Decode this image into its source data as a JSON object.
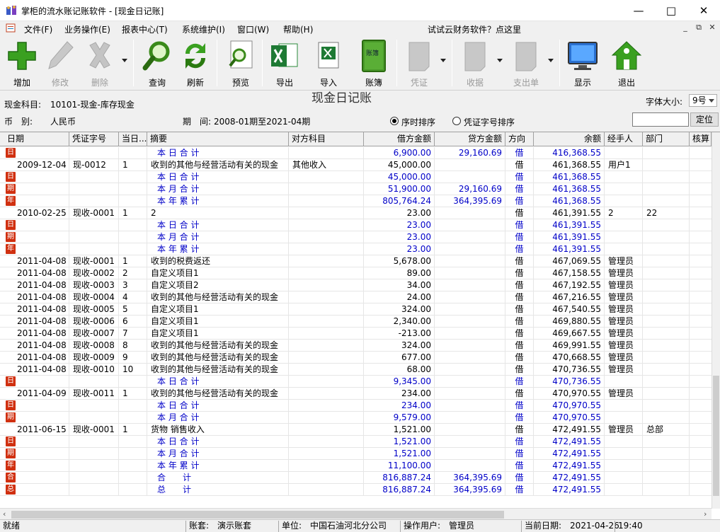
{
  "window": {
    "title": "掌柜的流水账记账软件 - [现金日记账]"
  },
  "menu": {
    "items": [
      "文件(F)",
      "业务操作(E)",
      "报表中心(T)",
      "系统维护(I)",
      "窗口(W)",
      "帮助(H)"
    ],
    "promo": "试试云财务软件？点这里"
  },
  "toolbar": {
    "add": "增加",
    "edit": "修改",
    "delete": "删除",
    "query": "查询",
    "refresh": "刷新",
    "preview": "预览",
    "export": "导出",
    "import": "导入",
    "ledger": "账簿",
    "ledger_book_text": "账簿",
    "voucher": "凭证",
    "receipt": "收据",
    "payment": "支出单",
    "display": "显示",
    "exit": "退出"
  },
  "info": {
    "account_label": "现金科目:",
    "account_value": "10101-现金-库存现金",
    "report_title": "现金日记账",
    "font_size_label": "字体大小:",
    "font_size_value": "9号",
    "currency_label": "币　别:",
    "currency_value": "人民币",
    "period_label": "期　间:",
    "period_value": "2008-01期至2021-04期",
    "sort_time": "序时排序",
    "sort_voucher": "凭证字号排序",
    "locate_button": "定位"
  },
  "grid": {
    "columns": [
      "日期",
      "凭证字号",
      "当日...",
      "摘要",
      "对方科目",
      "借方金额",
      "贷方金额",
      "方向",
      "余额",
      "经手人",
      "部门",
      "核算"
    ],
    "rows": [
      {
        "tag": "日",
        "date": "",
        "voucher": "",
        "seq": "",
        "summary": "本 日 合 计",
        "counter": "",
        "debit": "6,900.00",
        "credit": "29,160.69",
        "dir": "借",
        "balance": "416,368.55",
        "handler": "",
        "dept": "",
        "sum": true
      },
      {
        "tag": "",
        "date": "2009-12-04",
        "voucher": "现-0012",
        "seq": "1",
        "summary": "收到的其他与经营活动有关的现金",
        "counter": "其他收入",
        "debit": "45,000.00",
        "credit": "",
        "dir": "借",
        "balance": "461,368.55",
        "handler": "用户1",
        "dept": "",
        "sum": false
      },
      {
        "tag": "日",
        "date": "",
        "voucher": "",
        "seq": "",
        "summary": "本 日 合 计",
        "counter": "",
        "debit": "45,000.00",
        "credit": "",
        "dir": "借",
        "balance": "461,368.55",
        "handler": "",
        "dept": "",
        "sum": true
      },
      {
        "tag": "期",
        "date": "",
        "voucher": "",
        "seq": "",
        "summary": "本 月 合 计",
        "counter": "",
        "debit": "51,900.00",
        "credit": "29,160.69",
        "dir": "借",
        "balance": "461,368.55",
        "handler": "",
        "dept": "",
        "sum": true
      },
      {
        "tag": "年",
        "date": "",
        "voucher": "",
        "seq": "",
        "summary": "本 年 累 计",
        "counter": "",
        "debit": "805,764.24",
        "credit": "364,395.69",
        "dir": "借",
        "balance": "461,368.55",
        "handler": "",
        "dept": "",
        "sum": true
      },
      {
        "tag": "",
        "date": "2010-02-25",
        "voucher": "现收-0001",
        "seq": "1",
        "summary": "2",
        "counter": "",
        "debit": "23.00",
        "credit": "",
        "dir": "借",
        "balance": "461,391.55",
        "handler": "2",
        "dept": "22",
        "sum": false
      },
      {
        "tag": "日",
        "date": "",
        "voucher": "",
        "seq": "",
        "summary": "本 日 合 计",
        "counter": "",
        "debit": "23.00",
        "credit": "",
        "dir": "借",
        "balance": "461,391.55",
        "handler": "",
        "dept": "",
        "sum": true
      },
      {
        "tag": "期",
        "date": "",
        "voucher": "",
        "seq": "",
        "summary": "本 月 合 计",
        "counter": "",
        "debit": "23.00",
        "credit": "",
        "dir": "借",
        "balance": "461,391.55",
        "handler": "",
        "dept": "",
        "sum": true
      },
      {
        "tag": "年",
        "date": "",
        "voucher": "",
        "seq": "",
        "summary": "本 年 累 计",
        "counter": "",
        "debit": "23.00",
        "credit": "",
        "dir": "借",
        "balance": "461,391.55",
        "handler": "",
        "dept": "",
        "sum": true
      },
      {
        "tag": "",
        "date": "2011-04-08",
        "voucher": "现收-0001",
        "seq": "1",
        "summary": "收到的税费返还",
        "counter": "",
        "debit": "5,678.00",
        "credit": "",
        "dir": "借",
        "balance": "467,069.55",
        "handler": "管理员",
        "dept": "",
        "sum": false
      },
      {
        "tag": "",
        "date": "2011-04-08",
        "voucher": "现收-0002",
        "seq": "2",
        "summary": "自定义项目1",
        "counter": "",
        "debit": "89.00",
        "credit": "",
        "dir": "借",
        "balance": "467,158.55",
        "handler": "管理员",
        "dept": "",
        "sum": false
      },
      {
        "tag": "",
        "date": "2011-04-08",
        "voucher": "现收-0003",
        "seq": "3",
        "summary": "自定义项目2",
        "counter": "",
        "debit": "34.00",
        "credit": "",
        "dir": "借",
        "balance": "467,192.55",
        "handler": "管理员",
        "dept": "",
        "sum": false
      },
      {
        "tag": "",
        "date": "2011-04-08",
        "voucher": "现收-0004",
        "seq": "4",
        "summary": "收到的其他与经营活动有关的现金",
        "counter": "",
        "debit": "24.00",
        "credit": "",
        "dir": "借",
        "balance": "467,216.55",
        "handler": "管理员",
        "dept": "",
        "sum": false
      },
      {
        "tag": "",
        "date": "2011-04-08",
        "voucher": "现收-0005",
        "seq": "5",
        "summary": "自定义项目1",
        "counter": "",
        "debit": "324.00",
        "credit": "",
        "dir": "借",
        "balance": "467,540.55",
        "handler": "管理员",
        "dept": "",
        "sum": false
      },
      {
        "tag": "",
        "date": "2011-04-08",
        "voucher": "现收-0006",
        "seq": "6",
        "summary": "自定义项目1",
        "counter": "",
        "debit": "2,340.00",
        "credit": "",
        "dir": "借",
        "balance": "469,880.55",
        "handler": "管理员",
        "dept": "",
        "sum": false
      },
      {
        "tag": "",
        "date": "2011-04-08",
        "voucher": "现收-0007",
        "seq": "7",
        "summary": "自定义项目1",
        "counter": "",
        "debit": "-213.00",
        "credit": "",
        "dir": "借",
        "balance": "469,667.55",
        "handler": "管理员",
        "dept": "",
        "sum": false
      },
      {
        "tag": "",
        "date": "2011-04-08",
        "voucher": "现收-0008",
        "seq": "8",
        "summary": "收到的其他与经营活动有关的现金",
        "counter": "",
        "debit": "324.00",
        "credit": "",
        "dir": "借",
        "balance": "469,991.55",
        "handler": "管理员",
        "dept": "",
        "sum": false
      },
      {
        "tag": "",
        "date": "2011-04-08",
        "voucher": "现收-0009",
        "seq": "9",
        "summary": "收到的其他与经营活动有关的现金",
        "counter": "",
        "debit": "677.00",
        "credit": "",
        "dir": "借",
        "balance": "470,668.55",
        "handler": "管理员",
        "dept": "",
        "sum": false
      },
      {
        "tag": "",
        "date": "2011-04-08",
        "voucher": "现收-0010",
        "seq": "10",
        "summary": "收到的其他与经营活动有关的现金",
        "counter": "",
        "debit": "68.00",
        "credit": "",
        "dir": "借",
        "balance": "470,736.55",
        "handler": "管理员",
        "dept": "",
        "sum": false
      },
      {
        "tag": "日",
        "date": "",
        "voucher": "",
        "seq": "",
        "summary": "本 日 合 计",
        "counter": "",
        "debit": "9,345.00",
        "credit": "",
        "dir": "借",
        "balance": "470,736.55",
        "handler": "",
        "dept": "",
        "sum": true
      },
      {
        "tag": "",
        "date": "2011-04-09",
        "voucher": "现收-0011",
        "seq": "1",
        "summary": "收到的其他与经营活动有关的现金",
        "counter": "",
        "debit": "234.00",
        "credit": "",
        "dir": "借",
        "balance": "470,970.55",
        "handler": "管理员",
        "dept": "",
        "sum": false
      },
      {
        "tag": "日",
        "date": "",
        "voucher": "",
        "seq": "",
        "summary": "本 日 合 计",
        "counter": "",
        "debit": "234.00",
        "credit": "",
        "dir": "借",
        "balance": "470,970.55",
        "handler": "",
        "dept": "",
        "sum": true
      },
      {
        "tag": "期",
        "date": "",
        "voucher": "",
        "seq": "",
        "summary": "本 月 合 计",
        "counter": "",
        "debit": "9,579.00",
        "credit": "",
        "dir": "借",
        "balance": "470,970.55",
        "handler": "",
        "dept": "",
        "sum": true
      },
      {
        "tag": "",
        "date": "2011-06-15",
        "voucher": "现收-0001",
        "seq": "1",
        "summary": "货物 销售收入",
        "counter": "",
        "debit": "1,521.00",
        "credit": "",
        "dir": "借",
        "balance": "472,491.55",
        "handler": "管理员",
        "dept": "总部",
        "sum": false
      },
      {
        "tag": "日",
        "date": "",
        "voucher": "",
        "seq": "",
        "summary": "本 日 合 计",
        "counter": "",
        "debit": "1,521.00",
        "credit": "",
        "dir": "借",
        "balance": "472,491.55",
        "handler": "",
        "dept": "",
        "sum": true
      },
      {
        "tag": "期",
        "date": "",
        "voucher": "",
        "seq": "",
        "summary": "本 月 合 计",
        "counter": "",
        "debit": "1,521.00",
        "credit": "",
        "dir": "借",
        "balance": "472,491.55",
        "handler": "",
        "dept": "",
        "sum": true
      },
      {
        "tag": "年",
        "date": "",
        "voucher": "",
        "seq": "",
        "summary": "本 年 累 计",
        "counter": "",
        "debit": "11,100.00",
        "credit": "",
        "dir": "借",
        "balance": "472,491.55",
        "handler": "",
        "dept": "",
        "sum": true
      },
      {
        "tag": "合",
        "date": "",
        "voucher": "",
        "seq": "",
        "summary": "合　　计",
        "counter": "",
        "debit": "816,887.24",
        "credit": "364,395.69",
        "dir": "借",
        "balance": "472,491.55",
        "handler": "",
        "dept": "",
        "sum": true
      },
      {
        "tag": "总",
        "date": "",
        "voucher": "",
        "seq": "",
        "summary": "总　　计",
        "counter": "",
        "debit": "816,887.24",
        "credit": "364,395.69",
        "dir": "借",
        "balance": "472,491.55",
        "handler": "",
        "dept": "",
        "sum": true
      }
    ]
  },
  "status": {
    "ready": "就绪",
    "book": "账套:　演示账套",
    "company": "单位:　中国石油河北分公司",
    "user": "操作用户:　管理员",
    "date": "当前日期:　2021-04-26",
    "time": "19:40"
  }
}
